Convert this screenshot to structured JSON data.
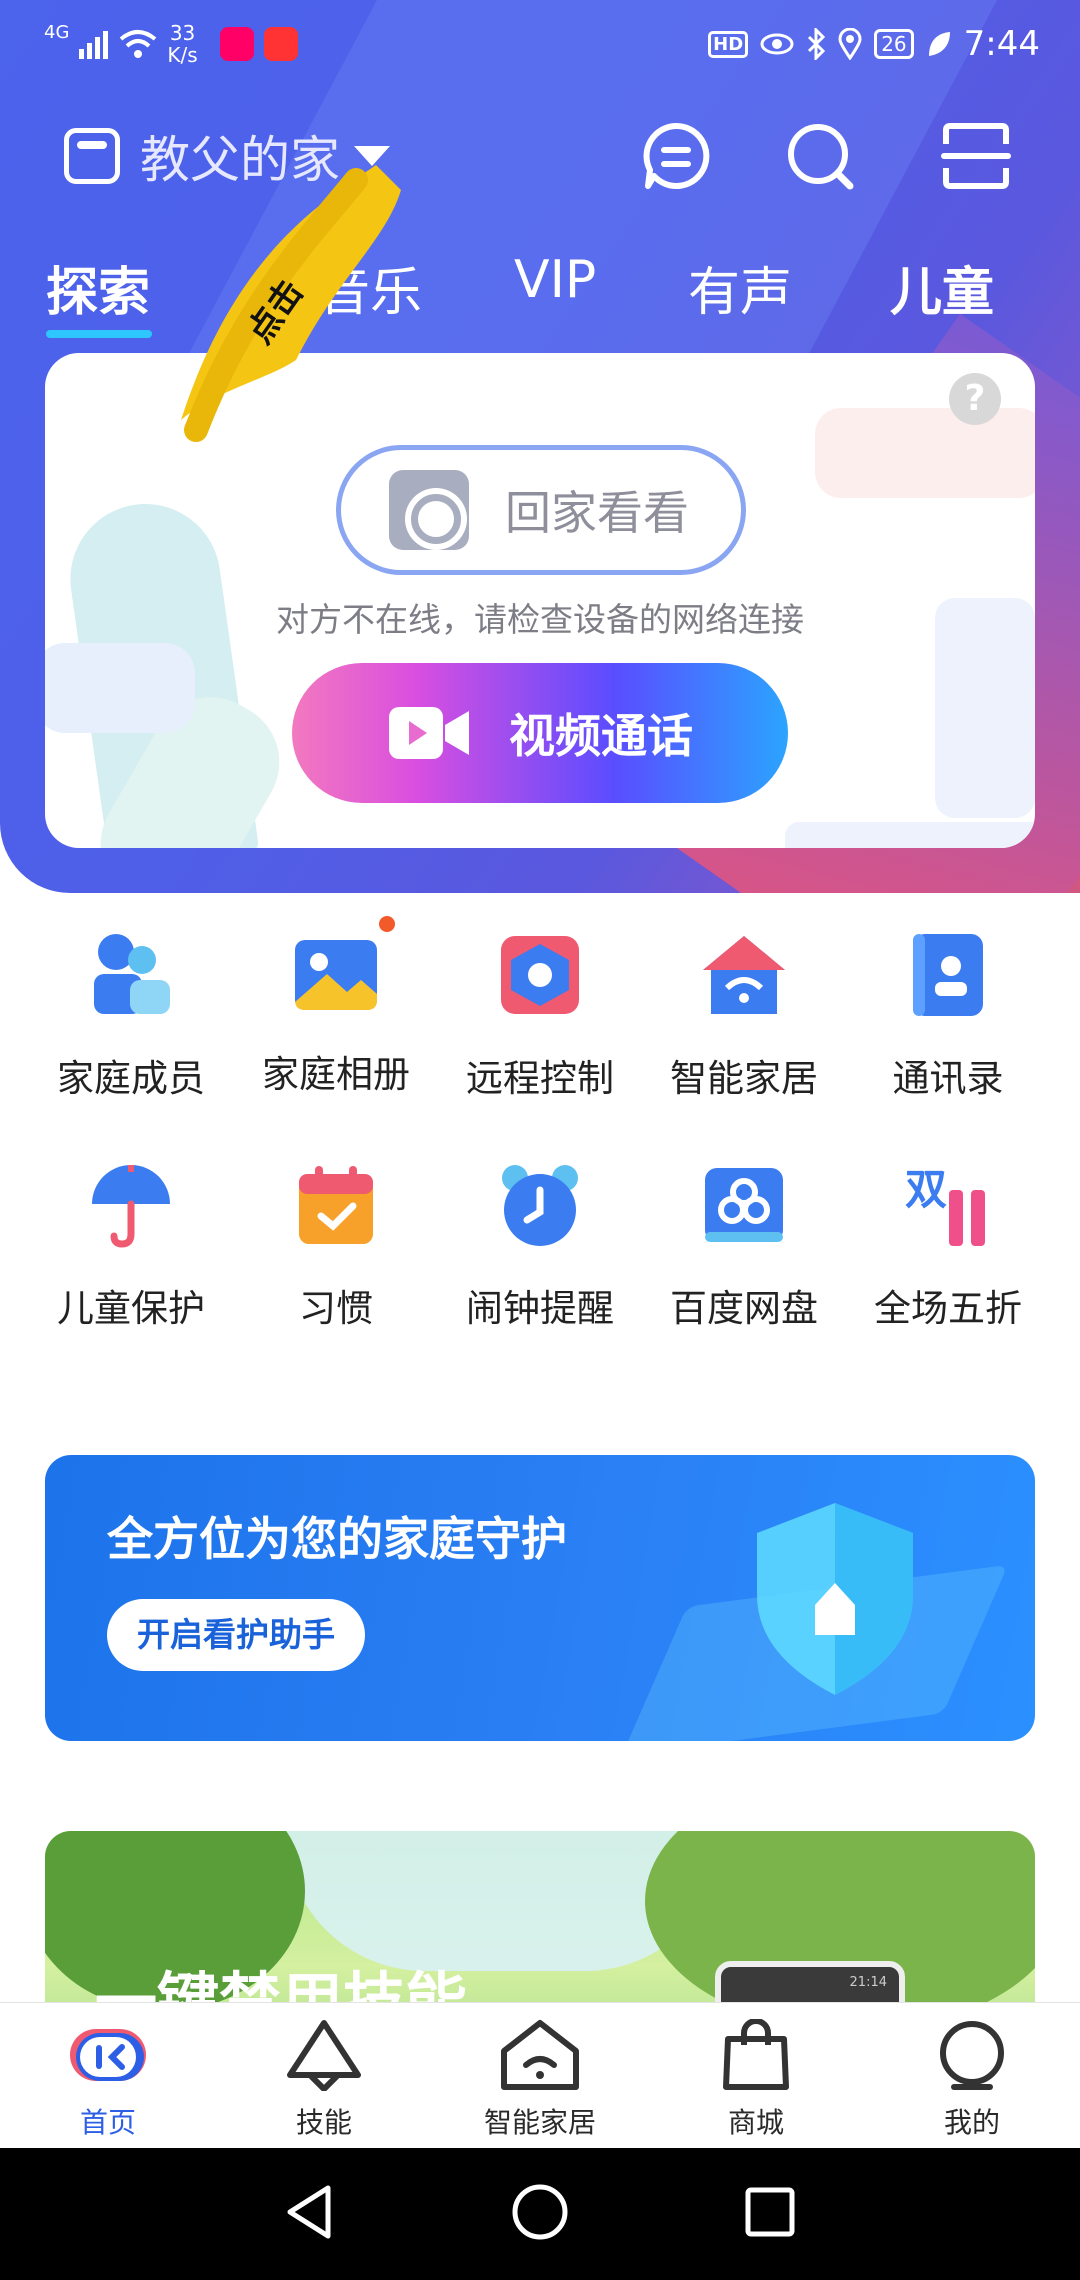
{
  "status_bar": {
    "network": "4G",
    "speed_value": "33",
    "speed_unit": "K/s",
    "hd": "HD",
    "battery": "26",
    "time": "7:44"
  },
  "header": {
    "home_name": "教父的家",
    "overlay_stamp": "点击"
  },
  "tabs": [
    {
      "label": "探索",
      "active": true
    },
    {
      "label": "音乐",
      "active": false
    },
    {
      "label": "VIP",
      "active": false
    },
    {
      "label": "有声",
      "active": false
    },
    {
      "label": "儿童",
      "active": false
    }
  ],
  "card": {
    "help": "?",
    "go_home": "回家看看",
    "offline_msg": "对方不在线，请检查设备的网络连接",
    "video_call": "视频通话"
  },
  "grid": [
    {
      "label": "家庭成员",
      "icon": "family-members-icon"
    },
    {
      "label": "家庭相册",
      "icon": "family-album-icon",
      "badge": true
    },
    {
      "label": "远程控制",
      "icon": "remote-control-icon"
    },
    {
      "label": "智能家居",
      "icon": "smart-home-icon"
    },
    {
      "label": "通讯录",
      "icon": "contacts-icon"
    },
    {
      "label": "儿童保护",
      "icon": "child-protection-icon"
    },
    {
      "label": "习惯",
      "icon": "habit-icon"
    },
    {
      "label": "闹钟提醒",
      "icon": "alarm-icon"
    },
    {
      "label": "百度网盘",
      "icon": "baidu-netdisk-icon"
    },
    {
      "label": "全场五折",
      "icon": "double-eleven-icon"
    }
  ],
  "banner_guard": {
    "title": "全方位为您的家庭守护",
    "button": "开启看护助手"
  },
  "banner_skill": {
    "title": "一键禁用技能",
    "device_time": "21:14"
  },
  "bottom_nav": [
    {
      "label": "首页",
      "active": true
    },
    {
      "label": "技能",
      "active": false
    },
    {
      "label": "智能家居",
      "active": false
    },
    {
      "label": "商城",
      "active": false
    },
    {
      "label": "我的",
      "active": false
    }
  ],
  "colors": {
    "primary": "#4c63ec",
    "accent_tab": "#2ec6ff",
    "active_nav": "#2c5fe6",
    "badge": "#f25a2a"
  }
}
